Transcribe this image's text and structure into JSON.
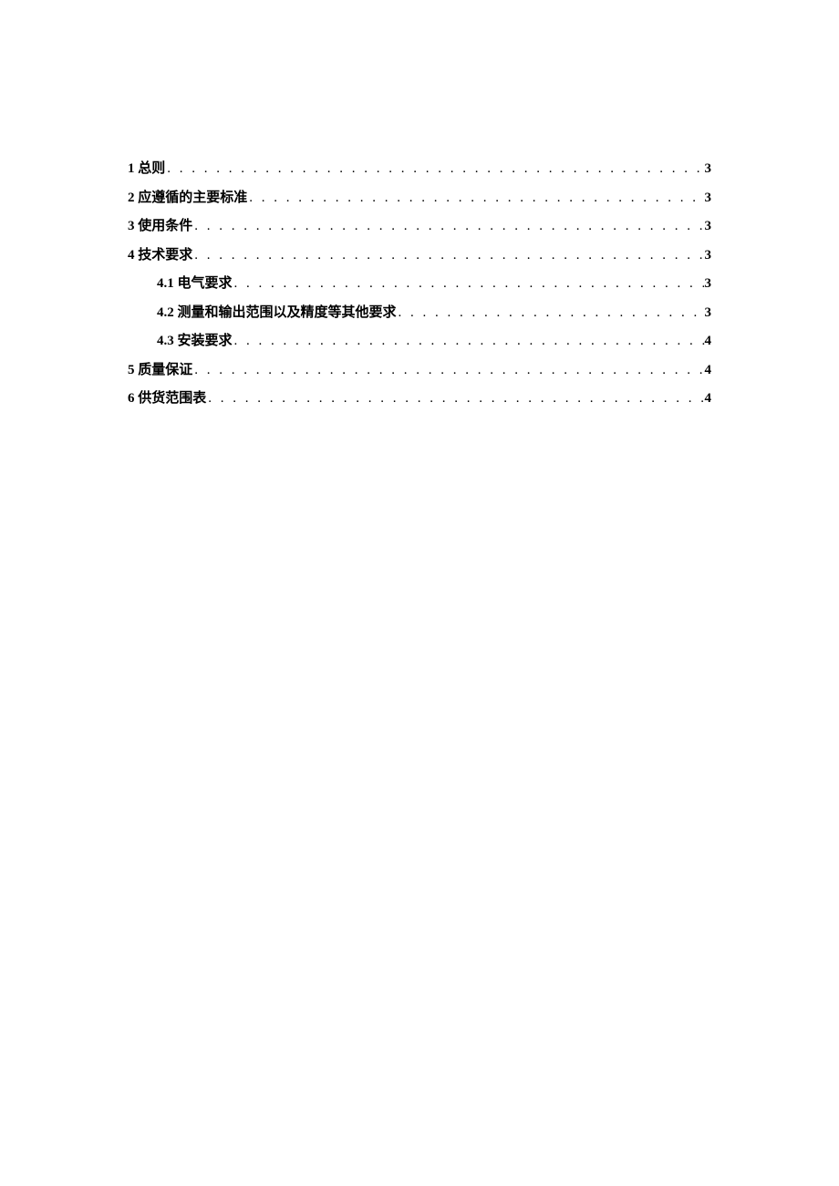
{
  "toc": [
    {
      "num": "1",
      "title": " 总则",
      "page": "3",
      "indent": false
    },
    {
      "num": "2",
      "title": " 应遵循的主要标准",
      "page": "3",
      "indent": false
    },
    {
      "num": "3",
      "title": " 使用条件",
      "page": "3",
      "indent": false
    },
    {
      "num": "4",
      "title": " 技术要求",
      "page": "3",
      "indent": false
    },
    {
      "num": "4.1",
      "title": " 电气要求",
      "page": "3",
      "indent": true
    },
    {
      "num": "4.2",
      "title": " 测量和输出范围以及精度等其他要求",
      "page": "3",
      "indent": true
    },
    {
      "num": "4.3",
      "title": " 安装要求",
      "page": "4",
      "indent": true
    },
    {
      "num": "5",
      "title": " 质量保证",
      "page": "4",
      "indent": false
    },
    {
      "num": "6",
      "title": " 供货范围表",
      "page": "4",
      "indent": false
    }
  ]
}
